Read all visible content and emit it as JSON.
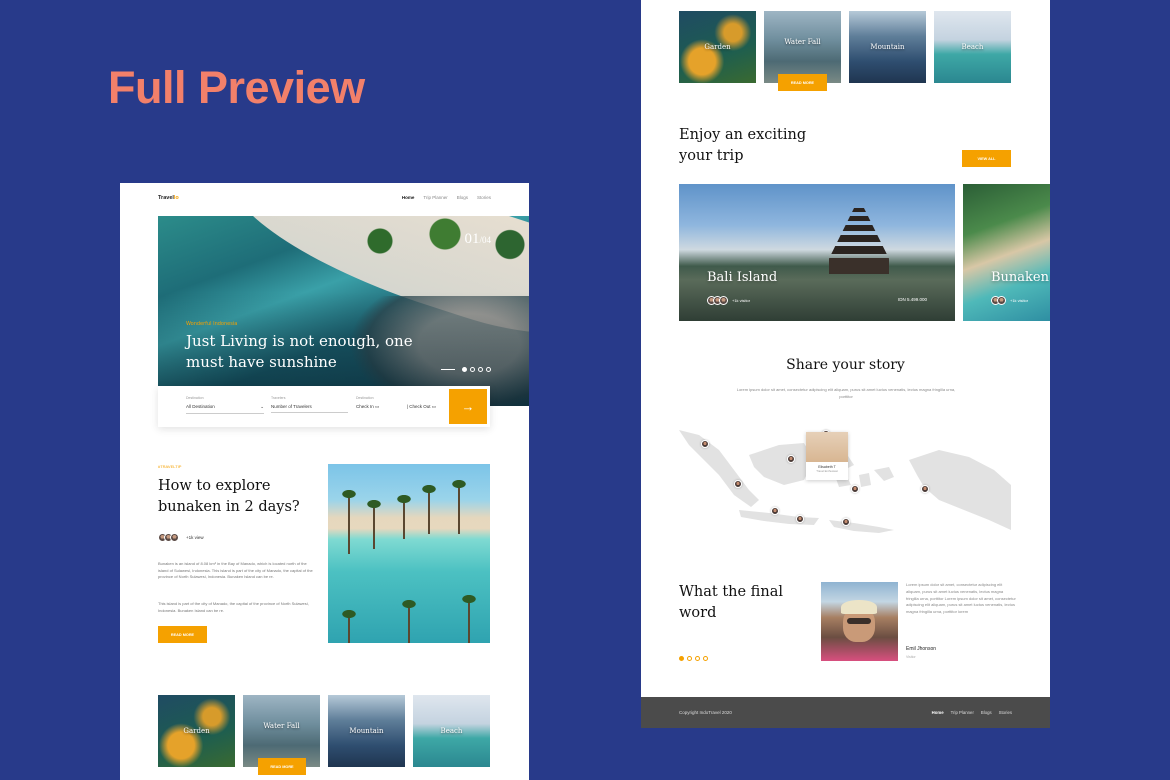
{
  "heading": "Full Preview",
  "colors": {
    "background": "#283a8a",
    "accent": "#f5a100",
    "heading": "#f2806a",
    "footer": "#4b4b4b"
  },
  "nav": {
    "logo_prefix": "Travel",
    "logo_suffix": "lo",
    "links": [
      "Home",
      "Trip Planner",
      "Blogs",
      "Stories"
    ]
  },
  "hero": {
    "counter_current": "01",
    "counter_total": "/04",
    "tagline": "Wonderful Indonesia",
    "title": "Just Living is not enough, one must have sunshine"
  },
  "search": {
    "destination_label": "Destination",
    "destination_value": "All Destination",
    "travelers_label": "Travelers",
    "travelers_value": "Number of Travelers",
    "dates_label": "Destination",
    "checkin": "Check In",
    "checkout": "Check Out",
    "go_icon": "arrow-right-icon"
  },
  "article": {
    "tag": "#TRAVELTIP",
    "title": "How to explore bunaken in 2 days?",
    "views": "+1k view",
    "para1": "Bunaken is an island of 8.08 km² in the Bay of Manado, which is located north of the island of Sulawesi, Indonesia. This island is part of the city of Manado, the capital of the province of North Sulawesi, Indonesia. Bunaken Island can be re.",
    "para2": "This island is part of the city of Manado, the capital of the province of North Sulawesi, Indonesia. Bunaken Island can be re.",
    "button": "READ MORE"
  },
  "thumbs": [
    "Garden",
    "Water Fall",
    "Mountain",
    "Beach"
  ],
  "thumb_button": "READ MORE",
  "trip": {
    "title": "Enjoy an exciting your trip",
    "button": "VIEW ALL",
    "cards": [
      {
        "name": "Bali Island",
        "visitors": "+1k visitor",
        "price": "IDN 5.499.000"
      },
      {
        "name": "Bunaken",
        "visitors": "+1k visitor"
      }
    ]
  },
  "story": {
    "title": "Share your story",
    "subtitle": "Lorem ipsum dolor sit amet, consectetur adipiscing elit aliquam, purus sit amet luctus venenatis, lectus magna fringilla urna, porttitor",
    "popup_name": "Elisabeth T",
    "popup_sub": "Travel Enthusiast"
  },
  "final": {
    "title": "What the final word",
    "quote": "Lorem ipsum dolor sit amet, consectetur adipiscing elit aliquam, purus sit amet luctus venenatis, lectus magna fringilla urna, porttitor Lorem ipsum dolor sit amet, consectetur adipiscing elit aliquam, purus sit amet luctus venenatis, lectus magna fringilla urna, porttitor lorem",
    "name": "Emil Jhonson",
    "role": "Visitor"
  },
  "footer": {
    "copyright": "Copyright IndoTravel 2020",
    "links": [
      "Home",
      "Trip Planner",
      "Blogs",
      "Stories"
    ]
  }
}
